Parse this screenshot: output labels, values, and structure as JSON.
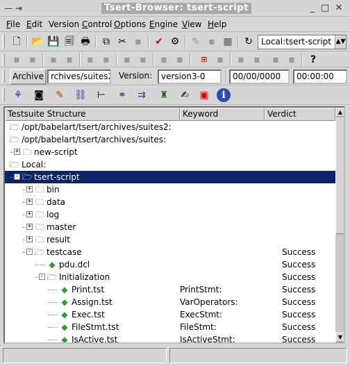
{
  "window": {
    "title": "Tsert-Browser: tsert-script",
    "left_controls": "— ⇥",
    "minimize": "_",
    "maximize": "□",
    "close": "✕"
  },
  "menu": [
    {
      "label": "File",
      "underline": "F",
      "rest": "ile"
    },
    {
      "label": "Edit",
      "underline": "E",
      "rest": "dit"
    },
    {
      "label": "Version Control",
      "pre": "Version ",
      "underline": "C",
      "rest": "ontrol"
    },
    {
      "label": "Options",
      "underline": "O",
      "rest": "ptions"
    },
    {
      "label": "Engine",
      "underline": "E",
      "rest": "ngine"
    },
    {
      "label": "View",
      "underline": "V",
      "rest": "iew"
    },
    {
      "label": "Help",
      "underline": "H",
      "rest": "elp"
    }
  ],
  "toolbar1": {
    "icons": [
      "new-file-icon",
      "open-folder-icon",
      "save-icon",
      "save-all-icon",
      "print-icon",
      "copy-icon",
      "cut-icon",
      "paste-icon",
      "spellcheck-icon",
      "settings-gear-icon",
      "edit-disabled-icon",
      "save-disabled-icon",
      "grid-icon",
      "refresh-icon"
    ],
    "workspace_select": "Local:tsert-script"
  },
  "toolbar2": {
    "icons": [
      "cvs-add-icon",
      "context-help-icon"
    ]
  },
  "version_bar": {
    "archive_button": "Archive",
    "archive_path": "rchives/suites2",
    "version_label": "Version:",
    "version_value": "version3-0",
    "date_value": "00/00/0000",
    "time_value": "00:00:00"
  },
  "toolbar4": {
    "icons": [
      "suite-tree-icon",
      "capture-icon",
      "brush-icon",
      "connect-icon",
      "hierarchy-icon",
      "link-icon",
      "transfer-icon",
      "engine-icon",
      "signature-icon",
      "monitor-check-icon",
      "info-icon"
    ]
  },
  "tree": {
    "headers": [
      "Testsuite Structure",
      "Keyword",
      "Verdict"
    ],
    "rows": [
      {
        "name": "/opt/babelart/tsert/archives/suites2:",
        "keyword": "",
        "verdict": "",
        "level": 0,
        "expander": "",
        "icon": "open",
        "selected": false
      },
      {
        "name": "/opt/babelart/tsert/archives/suites:",
        "keyword": "",
        "verdict": "",
        "level": 0,
        "expander": "",
        "icon": "open",
        "selected": false
      },
      {
        "name": "new-script",
        "keyword": "",
        "verdict": "",
        "level": 1,
        "expander": "+",
        "icon": "folder",
        "selected": false
      },
      {
        "name": "Local:",
        "keyword": "",
        "verdict": "",
        "level": 0,
        "expander": "",
        "icon": "open",
        "selected": false
      },
      {
        "name": "tsert-script",
        "keyword": "",
        "verdict": "",
        "level": 1,
        "expander": "−",
        "icon": "open",
        "selected": true
      },
      {
        "name": "bin",
        "keyword": "",
        "verdict": "",
        "level": 2,
        "expander": "+",
        "icon": "folder",
        "selected": false
      },
      {
        "name": "data",
        "keyword": "",
        "verdict": "",
        "level": 2,
        "expander": "+",
        "icon": "folder",
        "selected": false
      },
      {
        "name": "log",
        "keyword": "",
        "verdict": "",
        "level": 2,
        "expander": "+",
        "icon": "folder",
        "selected": false
      },
      {
        "name": "master",
        "keyword": "",
        "verdict": "",
        "level": 2,
        "expander": "+",
        "icon": "folder",
        "selected": false
      },
      {
        "name": "result",
        "keyword": "",
        "verdict": "",
        "level": 2,
        "expander": "+",
        "icon": "folder",
        "selected": false
      },
      {
        "name": "testcase",
        "keyword": "",
        "verdict": "Success",
        "level": 2,
        "expander": "−",
        "icon": "open",
        "selected": false
      },
      {
        "name": "pdu.dcl",
        "keyword": "",
        "verdict": "Success",
        "level": 3,
        "expander": "",
        "icon": "leaf",
        "selected": false
      },
      {
        "name": "Initialization",
        "keyword": "",
        "verdict": "Success",
        "level": 3,
        "expander": "−",
        "icon": "open",
        "selected": false
      },
      {
        "name": "Print.tst",
        "keyword": "PrintStmt:",
        "verdict": "Success",
        "level": 4,
        "expander": "",
        "icon": "leaf",
        "selected": false
      },
      {
        "name": "Assign.tst",
        "keyword": "VarOperators:",
        "verdict": "Success",
        "level": 4,
        "expander": "",
        "icon": "leaf",
        "selected": false
      },
      {
        "name": "Exec.tst",
        "keyword": "ExecStmt:",
        "verdict": "Success",
        "level": 4,
        "expander": "",
        "icon": "leaf",
        "selected": false
      },
      {
        "name": "FileStmt.tst",
        "keyword": "FileStmt:",
        "verdict": "Success",
        "level": 4,
        "expander": "",
        "icon": "leaf",
        "selected": false
      },
      {
        "name": "IsActive.tst",
        "keyword": "IsActiveStmt:",
        "verdict": "Success",
        "level": 4,
        "expander": "",
        "icon": "leaf",
        "selected": false
      }
    ]
  },
  "status": {
    "left": "",
    "right": ""
  }
}
